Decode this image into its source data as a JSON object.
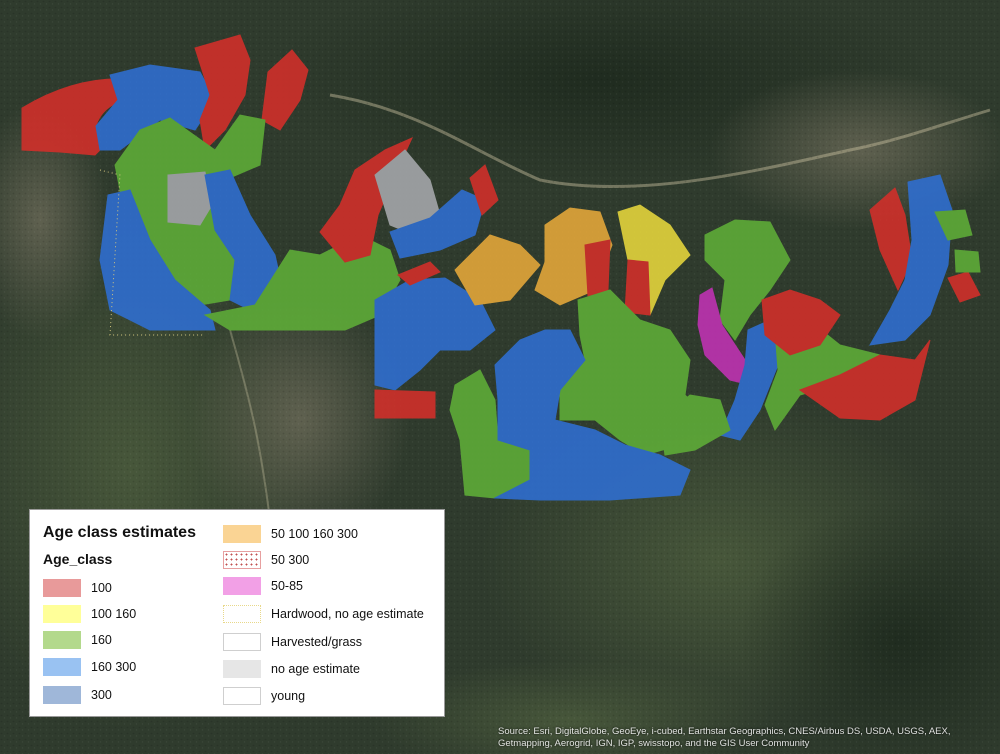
{
  "legend": {
    "title": "Age class estimates",
    "subtitle": "Age_class",
    "items": [
      {
        "label": "100",
        "fill": "#e89a9a",
        "pattern": "solid"
      },
      {
        "label": "100 160",
        "fill": "#ffff99",
        "pattern": "solid"
      },
      {
        "label": "160",
        "fill": "#b3d98c",
        "pattern": "solid"
      },
      {
        "label": "160 300",
        "fill": "#99c2f2",
        "pattern": "solid"
      },
      {
        "label": "300",
        "fill": "#9fb7d9",
        "pattern": "solid"
      },
      {
        "label": "50 100 160 300",
        "fill": "#fad494",
        "pattern": "solid"
      },
      {
        "label": "50 300",
        "fill": "#ffffff",
        "pattern": "dotted-red"
      },
      {
        "label": "50-85",
        "fill": "#f2a0e6",
        "pattern": "solid"
      },
      {
        "label": "Hardwood, no age estimate",
        "fill": "#ffffff",
        "pattern": "dotted-yellow"
      },
      {
        "label": "Harvested/grass",
        "fill": "#ffffff",
        "pattern": "outline"
      },
      {
        "label": "no age estimate",
        "fill": "#e6e6e6",
        "pattern": "solid"
      },
      {
        "label": "young",
        "fill": "#ffffff",
        "pattern": "outline"
      }
    ]
  },
  "map": {
    "colors": {
      "red": "#d42f2a",
      "green": "#5fae38",
      "blue": "#2f6fd3",
      "orange": "#e7a93a",
      "yellow": "#e8d83c",
      "magenta": "#c232b5",
      "gray": "#a7a9ad"
    }
  },
  "attribution": "Source: Esri, DigitalGlobe, GeoEye, i-cubed, Earthstar Geographics, CNES/Airbus DS, USDA, USGS, AEX, Getmapping, Aerogrid, IGN, IGP, swisstopo, and the GIS User Community"
}
